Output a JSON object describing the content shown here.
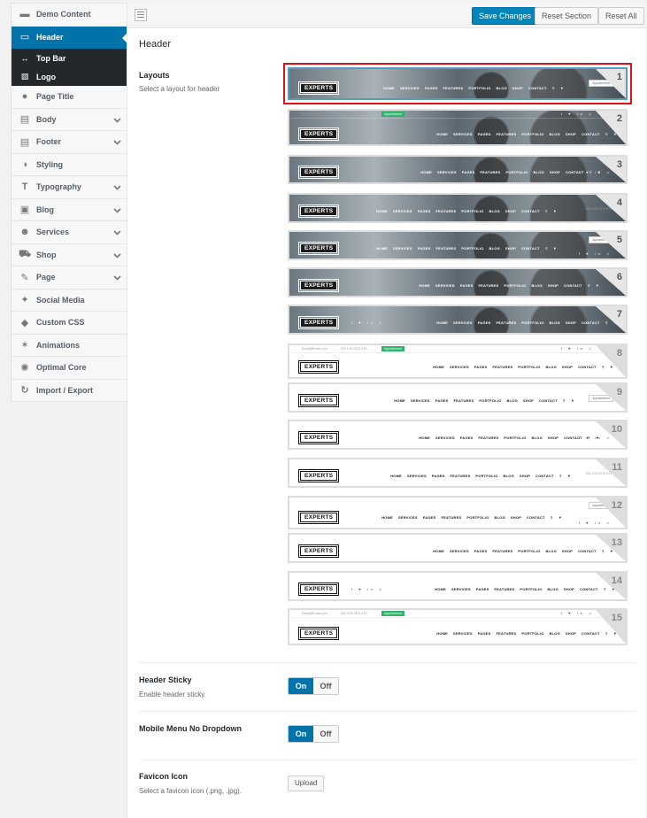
{
  "sidebar": {
    "items": [
      {
        "label": "Demo Content",
        "icon": "briefcase-icon",
        "glyph": "▬",
        "chevron": false
      },
      {
        "label": "Header",
        "icon": "header-icon",
        "glyph": "▭",
        "chevron": false,
        "active": true
      },
      {
        "label": "Page Title",
        "icon": "pin-icon",
        "glyph": "●",
        "chevron": false
      },
      {
        "label": "Body",
        "icon": "body-icon",
        "glyph": "▤",
        "chevron": true
      },
      {
        "label": "Footer",
        "icon": "footer-icon",
        "glyph": "▤",
        "chevron": true
      },
      {
        "label": "Styling",
        "icon": "contrast-icon",
        "glyph": "◑",
        "chevron": false
      },
      {
        "label": "Typography",
        "icon": "typography-icon",
        "glyph": "T",
        "chevron": true
      },
      {
        "label": "Blog",
        "icon": "blog-icon",
        "glyph": "▣",
        "chevron": true
      },
      {
        "label": "Services",
        "icon": "users-icon",
        "glyph": "☻",
        "chevron": true
      },
      {
        "label": "Shop",
        "icon": "cart-icon",
        "glyph": "⛟",
        "chevron": true
      },
      {
        "label": "Page",
        "icon": "edit-icon",
        "glyph": "✎",
        "chevron": true
      },
      {
        "label": "Social Media",
        "icon": "twitter-icon",
        "glyph": "✦",
        "chevron": false
      },
      {
        "label": "Custom CSS",
        "icon": "drop-icon",
        "glyph": "◆",
        "chevron": false
      },
      {
        "label": "Animations",
        "icon": "wand-icon",
        "glyph": "✶",
        "chevron": false
      },
      {
        "label": "Optimal Core",
        "icon": "bulb-icon",
        "glyph": "✺",
        "chevron": false
      },
      {
        "label": "Import / Export",
        "icon": "refresh-icon",
        "glyph": "↻",
        "chevron": false
      }
    ],
    "subitems": [
      {
        "label": "Top Bar",
        "icon": "arrows-horizontal-icon",
        "glyph": "↔"
      },
      {
        "label": "Logo",
        "icon": "image-icon",
        "glyph": "▨"
      }
    ]
  },
  "toolbar": {
    "save_label": "Save Changes",
    "reset_section_label": "Reset Section",
    "reset_all_label": "Reset All"
  },
  "section": {
    "title": "Header"
  },
  "layouts_row": {
    "title": "Layouts",
    "desc": "Select a layout for header",
    "selected": 1
  },
  "thumb": {
    "logo": "EXPERTS",
    "nav": [
      "HOME",
      "SERVICES",
      "PAGES",
      "FEATURES",
      "PORTFOLIO",
      "BLOG",
      "SHOP",
      "CONTACT"
    ],
    "appointment": "Appointment",
    "email": "Email@Email.com",
    "phone": "001 0 00 0173 973",
    "social": "f ♥ in ♫",
    "numbers": [
      "1",
      "2",
      "3",
      "4",
      "5",
      "6",
      "7",
      "8",
      "9",
      "10",
      "11",
      "12",
      "13",
      "14",
      "15"
    ]
  },
  "sticky_row": {
    "title": "Header Sticky",
    "desc": "Enable header sticky.",
    "on": "On",
    "off": "Off"
  },
  "mobile_row": {
    "title": "Mobile Menu No Dropdown",
    "on": "On",
    "off": "Off"
  },
  "favicon_row": {
    "title": "Favicon Icon",
    "desc": "Select a favicon icon (.png, .jpg).",
    "upload_label": "Upload"
  },
  "colors": {
    "accent": "#0073aa",
    "primary_button": "#0085ba",
    "selection_frame": "#e10f1a"
  }
}
